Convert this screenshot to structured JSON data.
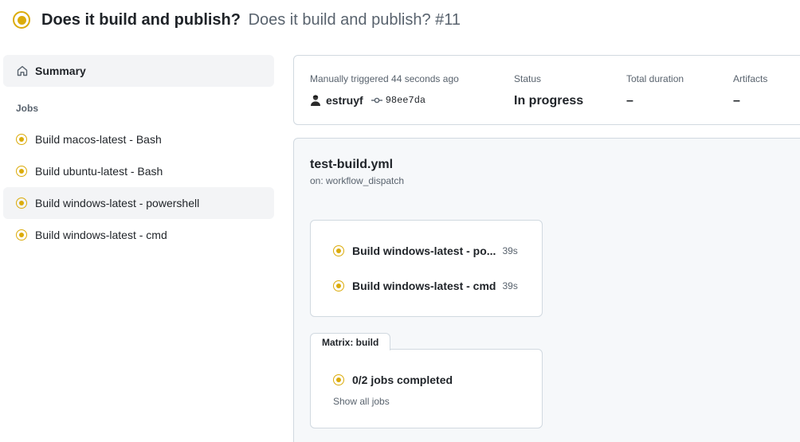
{
  "header": {
    "workflow_name": "Does it build and publish?",
    "run_title": "Does it build and publish? #11",
    "status_color": "#dbab0a"
  },
  "sidebar": {
    "summary_label": "Summary",
    "jobs_heading": "Jobs",
    "jobs": [
      {
        "label": "Build macos-latest - Bash",
        "status": "in_progress",
        "active": false
      },
      {
        "label": "Build ubuntu-latest - Bash",
        "status": "in_progress",
        "active": false
      },
      {
        "label": "Build windows-latest - powershell",
        "status": "in_progress",
        "active": true
      },
      {
        "label": "Build windows-latest - cmd",
        "status": "in_progress",
        "active": false
      }
    ]
  },
  "summary": {
    "trigger_label": "Manually triggered 44 seconds ago",
    "actor": "estruyf",
    "commit_sha": "98ee7da",
    "status_label": "Status",
    "status_value": "In progress",
    "duration_label": "Total duration",
    "duration_value": "–",
    "artifacts_label": "Artifacts",
    "artifacts_value": "–"
  },
  "graph": {
    "workflow_file": "test-build.yml",
    "trigger": "on: workflow_dispatch",
    "matrix_jobs": [
      {
        "label": "Build windows-latest - po...",
        "duration": "39s"
      },
      {
        "label": "Build windows-latest - cmd",
        "duration": "39s"
      }
    ],
    "matrix_tab_label": "Matrix: build",
    "completed_label": "0/2 jobs completed",
    "show_all_label": "Show all jobs"
  }
}
